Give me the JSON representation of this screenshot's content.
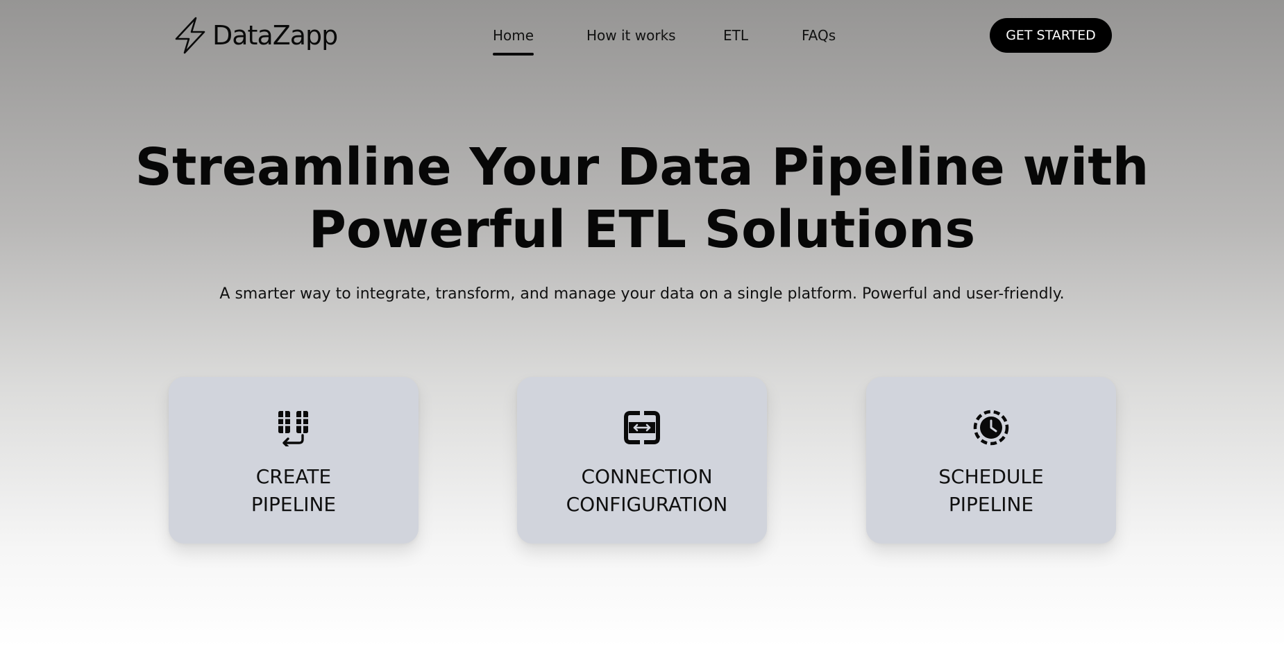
{
  "brand": {
    "name": "DataZapp",
    "logo_icon": "lightning-bolt-icon"
  },
  "nav": {
    "items": [
      {
        "label": "Home",
        "active": true
      },
      {
        "label": "How it works",
        "active": false
      },
      {
        "label": "ETL",
        "active": false
      },
      {
        "label": "FAQs",
        "active": false
      }
    ],
    "cta_label": "GET STARTED"
  },
  "hero": {
    "title_line1": "Streamline Your Data Pipeline with",
    "title_line2": "Powerful ETL Solutions",
    "subtitle": "A smarter way to integrate, transform, and manage your data on a single platform. Powerful and user-friendly."
  },
  "features": [
    {
      "icon": "pipeline-icon",
      "line1": "CREATE",
      "line2": "PIPELINE"
    },
    {
      "icon": "connection-icon",
      "line1": "CONNECTION",
      "line2": "CONFIGURATION"
    },
    {
      "icon": "schedule-clock-icon",
      "line1": "SCHEDULE",
      "line2": "PIPELINE"
    }
  ],
  "colors": {
    "accent": "#000000",
    "card_background": "#d1d4dc",
    "cta_text": "#ffffff"
  }
}
